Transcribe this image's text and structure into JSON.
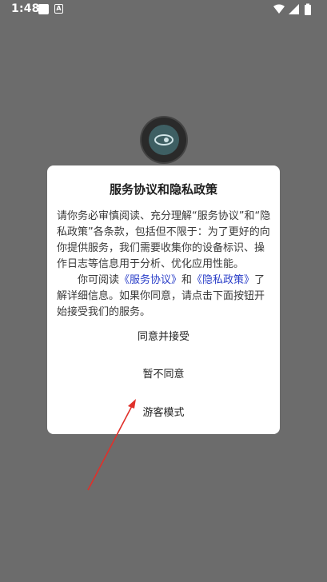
{
  "status_bar": {
    "time": "1:48",
    "notification_icon": "square-icon",
    "accessibility_icon": "a-box-icon",
    "wifi_icon": "wifi-icon",
    "signal_icon": "signal-icon",
    "battery_icon": "battery-icon",
    "a_glyph": "A"
  },
  "app": {
    "logo_icon": "app-logo-icon"
  },
  "dialog": {
    "title": "服务协议和隐私政策",
    "paragraph1": "请你务必审慎阅读、充分理解“服务协议”和“隐私政策”各条款，包括但不限于：为了更好的向你提供服务，我们需要收集你的设备标识、操作日志等信息用于分析、优化应用性能。",
    "paragraph2_prefix": "你可阅读",
    "service_link": "《服务协议》",
    "conjunction": "和",
    "privacy_link": "《隐私政策》",
    "paragraph2_suffix": "了解详细信息。如果你同意，请点击下面按钮开始接受我们的服务。",
    "accept_label": "同意并接受",
    "decline_label": "暂不同意",
    "guest_label": "游客模式"
  },
  "colors": {
    "overlay": "#6c6c6c",
    "link": "#2b3fc8",
    "annotation_arrow": "#e0302a"
  }
}
